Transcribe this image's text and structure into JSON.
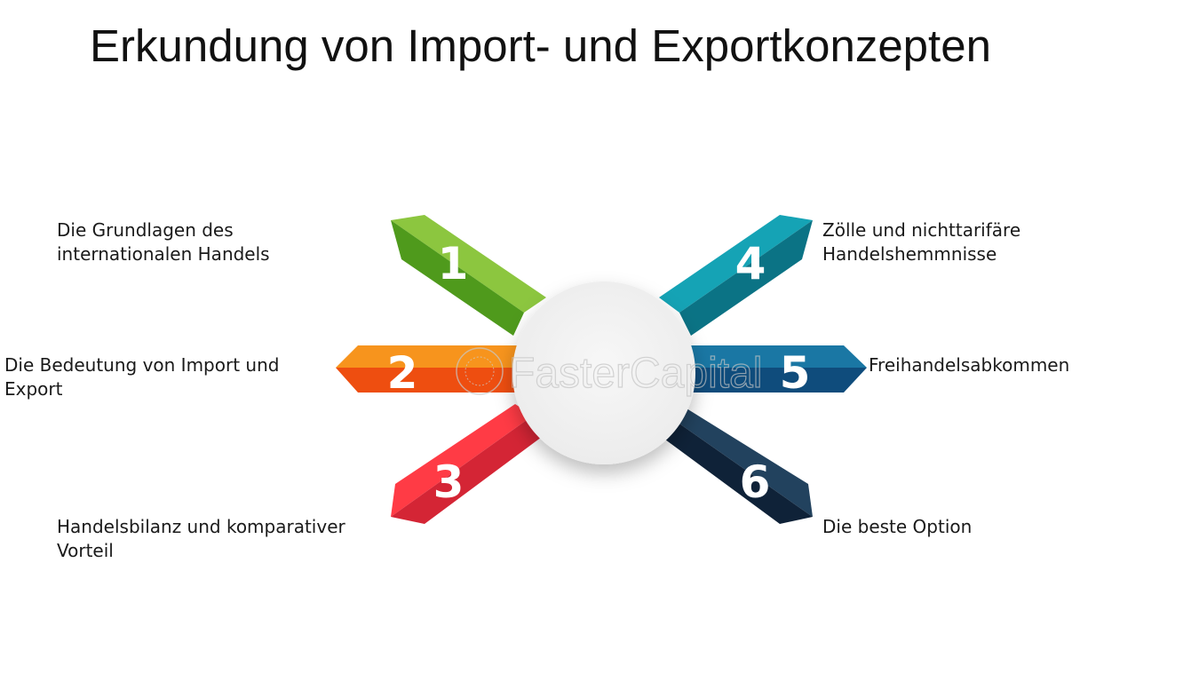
{
  "title": "Erkundung von Import- und Exportkonzepten",
  "watermark": "FasterCapital",
  "items": [
    {
      "number": "1",
      "lines": [
        "Die Grundlagen des",
        "internationalen Handels"
      ],
      "color_top": "#8cc63f",
      "color_side": "#4f9a1c"
    },
    {
      "number": "2",
      "lines": [
        "Die Bedeutung von Import und",
        "Export"
      ],
      "color_top": "#f7941d",
      "color_side": "#ee4e10"
    },
    {
      "number": "3",
      "lines": [
        "Handelsbilanz und komparativer",
        "Vorteil"
      ],
      "color_top": "#ff3b45",
      "color_side": "#d42535"
    },
    {
      "number": "4",
      "lines": [
        "Zölle und nichttarifäre",
        "Handelshemmnisse"
      ],
      "color_top": "#15a3b5",
      "color_side": "#0b7385"
    },
    {
      "number": "5",
      "lines": [
        "Freihandelsabkommen"
      ],
      "color_top": "#1a77a4",
      "color_side": "#0f4c7c"
    },
    {
      "number": "6",
      "lines": [
        "Die beste Option"
      ],
      "color_top": "#22425e",
      "color_side": "#0f2238"
    }
  ]
}
